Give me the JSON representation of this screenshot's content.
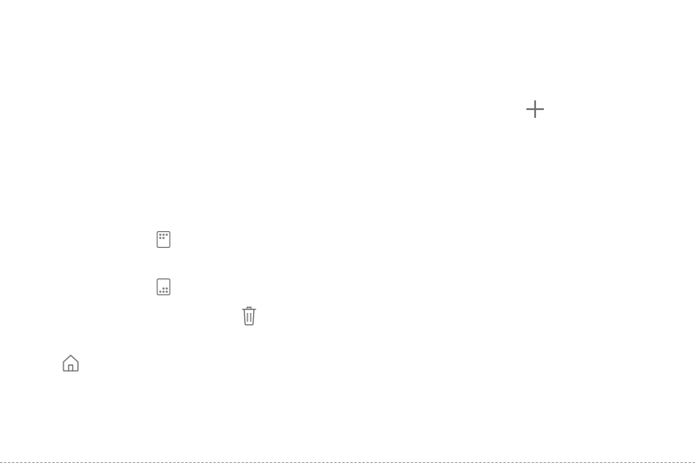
{
  "icons": {
    "add": "add-icon",
    "apps_screen_top": "apps-screen-layout-top-icon",
    "apps_screen_bottom": "apps-screen-layout-bottom-icon",
    "delete": "trash-icon",
    "home": "home-icon"
  },
  "colors": {
    "icon_stroke": "#707070",
    "background": "#ffffff"
  }
}
